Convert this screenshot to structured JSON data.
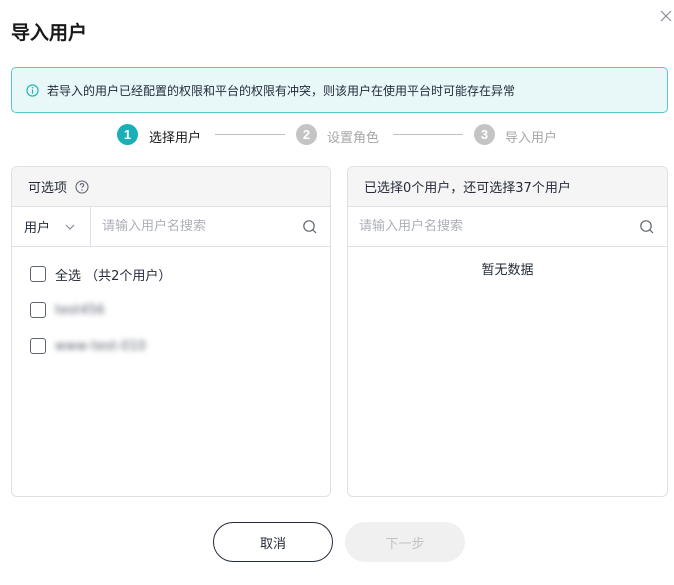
{
  "dialog": {
    "title": "导入用户",
    "close_icon": "close-icon"
  },
  "alert": {
    "icon": "info-icon",
    "text": "若导入的用户已经配置的权限和平台的权限有冲突，则该用户在使用平台时可能存在异常",
    "accent_color": "#1aafb7",
    "background_color": "#e8f8f9"
  },
  "steps": [
    {
      "number": "1",
      "label": "选择用户",
      "active": true
    },
    {
      "number": "2",
      "label": "设置角色",
      "active": false
    },
    {
      "number": "3",
      "label": "导入用户",
      "active": false
    }
  ],
  "left_panel": {
    "header": "可选项",
    "help_icon": "help-icon",
    "filter_value": "用户",
    "search_placeholder": "请输入用户名搜索",
    "select_all_label": "全选 （共2个用户）",
    "users": [
      {
        "name": "test456"
      },
      {
        "name": "www-test-010"
      }
    ]
  },
  "right_panel": {
    "header": "已选择0个用户，还可选择37个用户",
    "search_placeholder": "请输入用户名搜索",
    "empty_text": "暂无数据"
  },
  "footer": {
    "cancel_label": "取消",
    "next_label": "下一步"
  }
}
